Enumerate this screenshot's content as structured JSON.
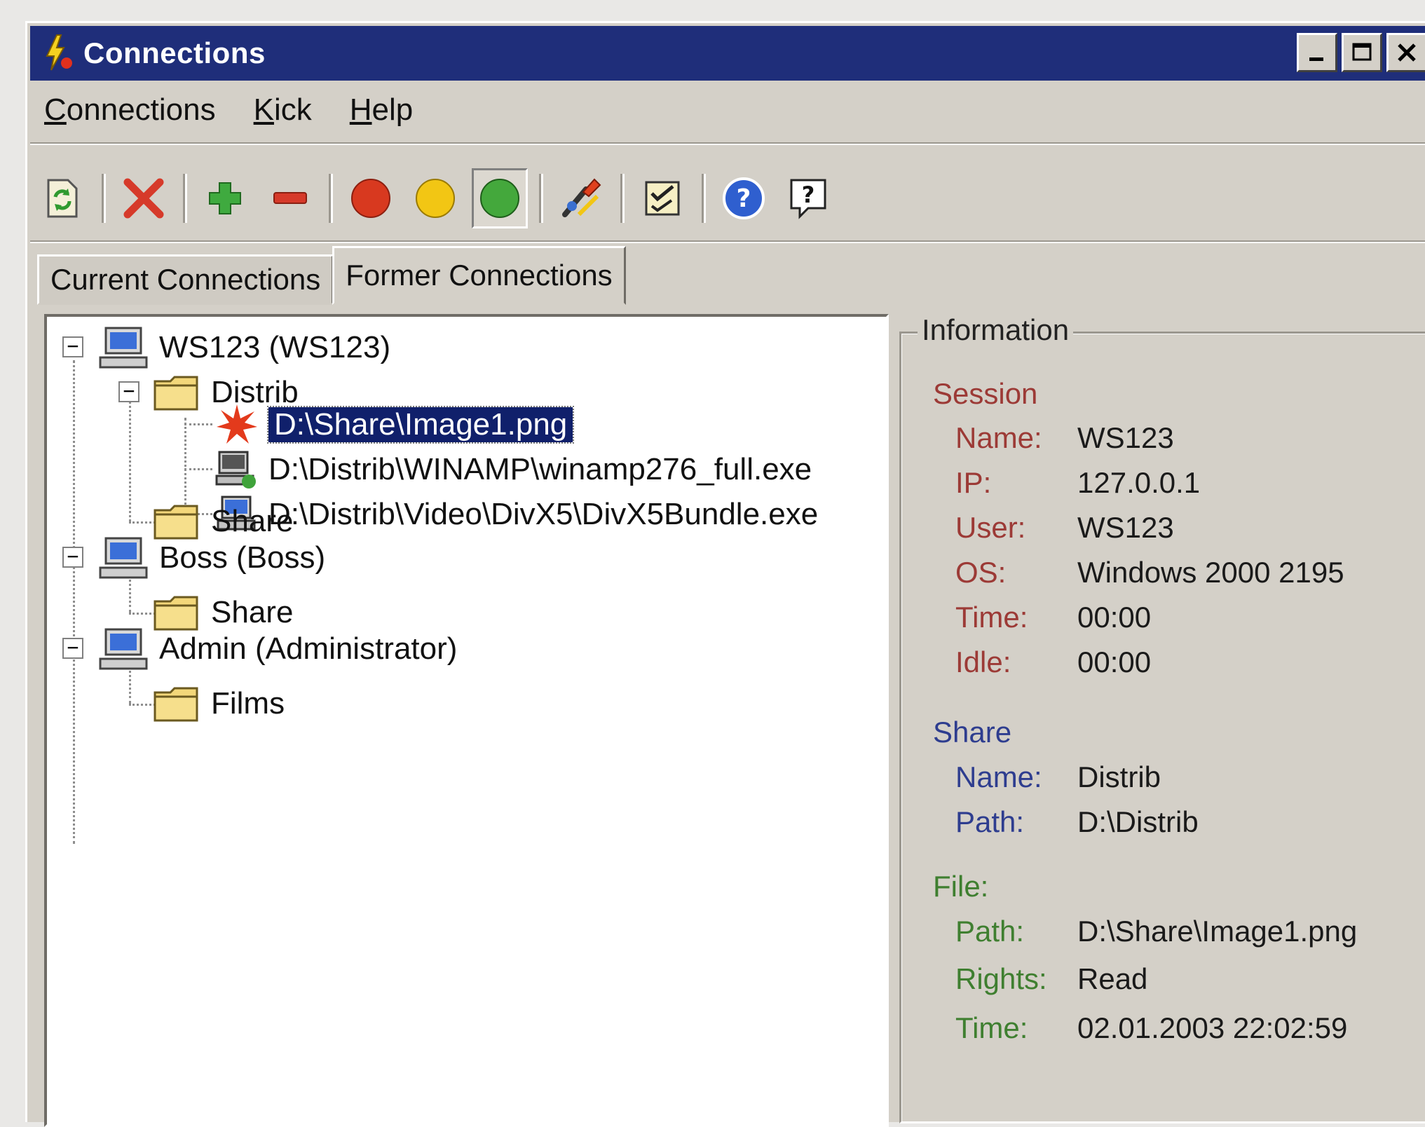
{
  "window": {
    "title": "Connections"
  },
  "menu": [
    {
      "label": "Connections",
      "accel": "C",
      "rest": "onnections"
    },
    {
      "label": "Kick",
      "accel": "K",
      "rest": "ick"
    },
    {
      "label": "Help",
      "accel": "H",
      "rest": "elp"
    }
  ],
  "toolbar": {
    "icons": [
      "refresh-icon",
      "delete-icon",
      "add-icon",
      "remove-icon",
      "red-status-icon",
      "yellow-status-icon",
      "green-status-icon",
      "tools-icon",
      "checklist-icon",
      "help-circle-icon",
      "context-help-icon"
    ],
    "colors": {
      "red": "#d23a1e",
      "yellow": "#f0c412",
      "green": "#3fa33a",
      "add": "#2f9a2f",
      "remove": "#d63a2a"
    }
  },
  "tabs": [
    {
      "label": "Current Connections",
      "accel": "u",
      "active": false
    },
    {
      "label": "Former Connections",
      "accel": "F",
      "active": true
    }
  ],
  "tree": {
    "nodes": [
      {
        "label": "WS123 (WS123)"
      },
      {
        "label": "Distrib"
      },
      {
        "label": "D:\\Share\\Image1.png",
        "selected": true
      },
      {
        "label": "D:\\Distrib\\WINAMP\\winamp276_full.exe"
      },
      {
        "label": "D:\\Distrib\\Video\\DivX5\\DivX5Bundle.exe"
      },
      {
        "label": "Share"
      },
      {
        "label": "Boss (Boss)"
      },
      {
        "label": "Share"
      },
      {
        "label": "Admin (Administrator)"
      },
      {
        "label": "Films"
      }
    ]
  },
  "info": {
    "title": "Information",
    "session": {
      "heading": "Session",
      "fields": [
        {
          "label": "Name:",
          "value": "WS123"
        },
        {
          "label": "IP:",
          "value": "127.0.0.1"
        },
        {
          "label": "User:",
          "value": "WS123"
        },
        {
          "label": "OS:",
          "value": "Windows 2000 2195"
        },
        {
          "label": "Time:",
          "value": "00:00"
        },
        {
          "label": "Idle:",
          "value": "00:00"
        }
      ]
    },
    "share": {
      "heading": "Share",
      "fields": [
        {
          "label": "Name:",
          "value": "Distrib"
        },
        {
          "label": "Path:",
          "value": "D:\\Distrib"
        }
      ]
    },
    "file": {
      "heading": "File:",
      "fields": [
        {
          "label": "Path:",
          "value": "D:\\Share\\Image1.png"
        },
        {
          "label": "Rights:",
          "value": "Read"
        },
        {
          "label": "Time:",
          "value": "02.01.2003 22:02:59"
        }
      ]
    }
  }
}
